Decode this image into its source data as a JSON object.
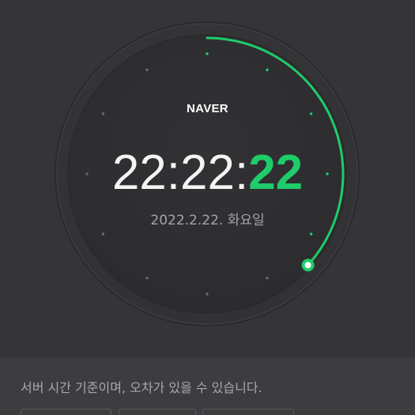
{
  "brand": {
    "name": "NAVER"
  },
  "clock": {
    "hours_minutes": "22:22:",
    "seconds": "22",
    "date": "2022.2.22. 화요일",
    "second_progress": 0.367,
    "accent_color": "#1fcc6a"
  },
  "notice": {
    "text": "서버 시간 기준이며, 오차가 있을 수 있습니다."
  },
  "bottom_buttons": [
    "",
    "",
    ""
  ]
}
